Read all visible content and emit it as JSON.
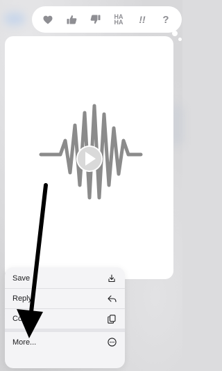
{
  "colors": {
    "accent_gray": "#8e8e93",
    "waveform": "#8b8b8b",
    "menu_text": "#1c1c1e",
    "arrow": "#000000"
  },
  "tapback": {
    "items": [
      {
        "name": "heart",
        "icon": "heart-icon"
      },
      {
        "name": "like",
        "icon": "thumbs-up-icon"
      },
      {
        "name": "dislike",
        "icon": "thumbs-down-icon"
      },
      {
        "name": "laugh",
        "label_top": "HA",
        "label_bottom": "HA"
      },
      {
        "name": "emphasize",
        "label": "!!"
      },
      {
        "name": "question",
        "label": "?"
      }
    ]
  },
  "audio_card": {
    "waveform_icon": "audio-waveform-icon",
    "play_icon": "play-icon"
  },
  "menu": {
    "items": [
      {
        "label": "Save",
        "icon": "save-download-icon"
      },
      {
        "label": "Reply",
        "icon": "reply-arrow-icon"
      },
      {
        "label": "Copy",
        "icon": "copy-icon"
      },
      {
        "label": "More...",
        "icon": "more-ellipsis-icon"
      }
    ]
  }
}
